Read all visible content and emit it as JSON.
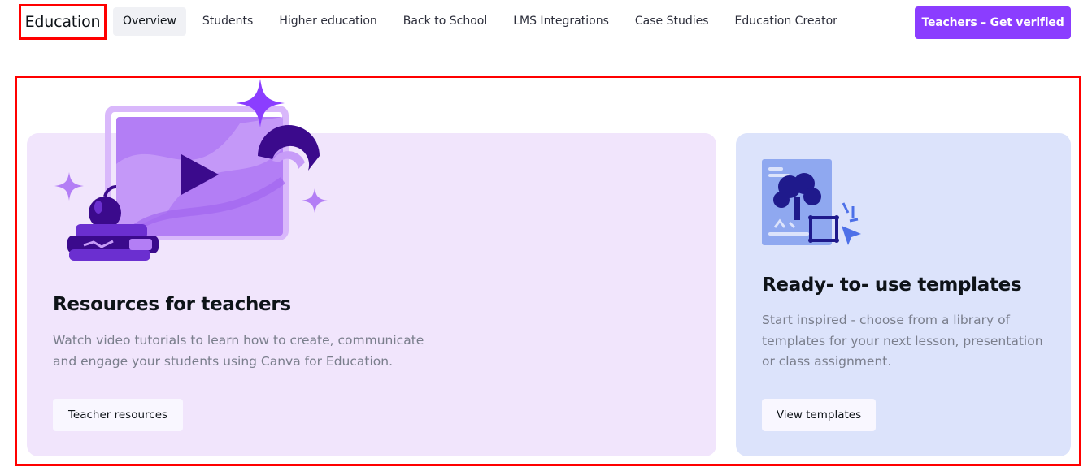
{
  "nav": {
    "brand": "Education",
    "links": [
      {
        "label": "Overview",
        "active": true
      },
      {
        "label": "Students",
        "active": false
      },
      {
        "label": "Higher education",
        "active": false
      },
      {
        "label": "Back to School",
        "active": false
      },
      {
        "label": "LMS Integrations",
        "active": false
      },
      {
        "label": "Case Studies",
        "active": false
      },
      {
        "label": "Education Creator",
        "active": false
      }
    ],
    "cta_label": "Teachers – Get verified"
  },
  "cards": {
    "teachers": {
      "title": "Resources for teachers",
      "description": "Watch video tutorials to learn how to create, communicate and engage your students using Canva for Education.",
      "button_label": "Teacher resources",
      "illustration": "video-play-illustration"
    },
    "templates": {
      "title": "Ready- to- use templates",
      "description": "Start inspired - choose from a library of templates for your next lesson, presentation or class assignment.",
      "button_label": "View templates",
      "illustration": "template-editor-illustration"
    }
  },
  "colors": {
    "accent": "#8b3dff",
    "highlight": "#ff0000",
    "teachers_card_bg": "#f1e5fc",
    "templates_card_bg": "#dce3fb"
  }
}
